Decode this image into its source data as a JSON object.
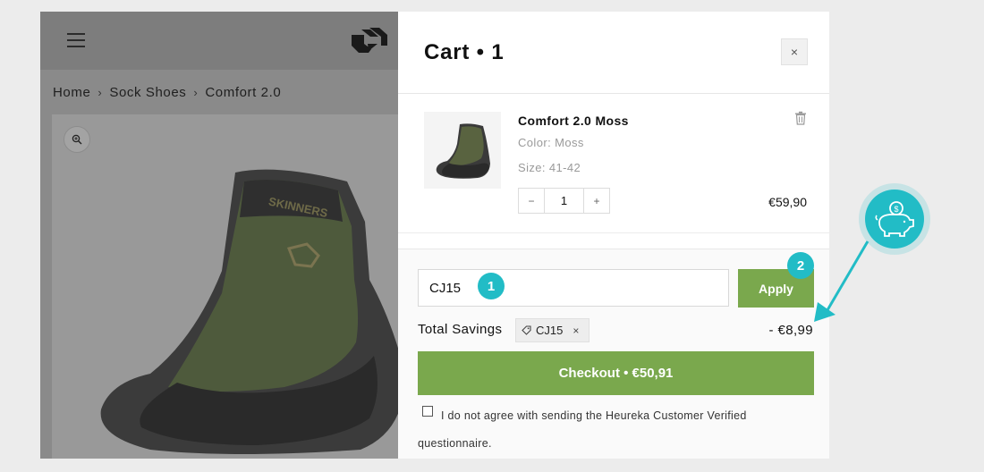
{
  "breadcrumb": [
    {
      "label": "Home"
    },
    {
      "label": "Sock Shoes"
    },
    {
      "label": "Comfort 2.0"
    }
  ],
  "breadcrumb_separator": "›",
  "cart": {
    "title": "Cart • 1",
    "close_label": "×",
    "item": {
      "name": "Comfort 2.0 Moss",
      "color": "Color: Moss",
      "size": "Size: 41-42",
      "quantity": "1",
      "minus_label": "−",
      "plus_label": "+",
      "price": "€59,90",
      "product_logo_text": "SKINNERS"
    },
    "coupon": {
      "value": "CJ15",
      "apply_label": "Apply"
    },
    "savings": {
      "label": "Total Savings",
      "chip_code": "CJ15",
      "chip_remove": "×",
      "value": "- €8,99"
    },
    "checkout_label": "Checkout • €50,91",
    "consent": {
      "text": "I do not agree with sending the Heureka Customer Verified questionnaire.",
      "checked": false
    }
  },
  "annotations": {
    "badge_1": "1",
    "badge_2": "2"
  },
  "colors": {
    "accent_green": "#7aa84d",
    "annotation_teal": "#22bcc6"
  },
  "icons": [
    "hamburger-icon",
    "brand-logo",
    "zoom-in-icon",
    "close-icon",
    "trash-icon",
    "tag-icon",
    "piggy-bank-icon"
  ]
}
